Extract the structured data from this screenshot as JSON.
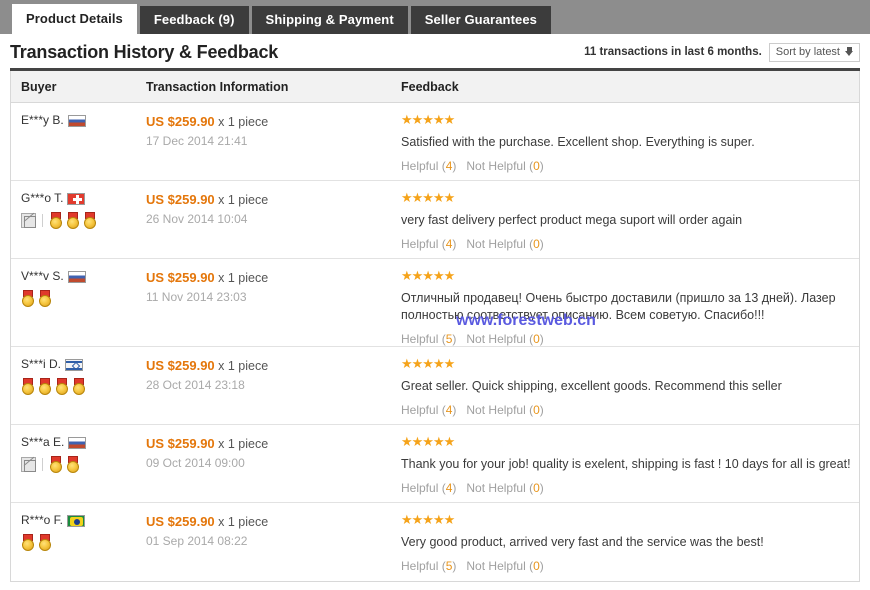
{
  "tabs": [
    {
      "label": "Product Details",
      "active": true
    },
    {
      "label": "Feedback (9)",
      "active": false
    },
    {
      "label": "Shipping & Payment",
      "active": false
    },
    {
      "label": "Seller Guarantees",
      "active": false
    }
  ],
  "section": {
    "title": "Transaction History & Feedback",
    "transaction_count_text": "11 transactions in last 6 months.",
    "sort_label": "Sort by latest"
  },
  "table": {
    "headers": {
      "buyer": "Buyer",
      "transaction": "Transaction Information",
      "feedback": "Feedback"
    },
    "rows": [
      {
        "buyer": "E***y B.",
        "flag": "flag-ru",
        "flag_name": "flag-russia",
        "badges": {
          "broken_icon": false,
          "medals": 0
        },
        "price_prefix": "US $259.90",
        "price_suffix": "x 1 piece",
        "date": "17 Dec 2014 21:41",
        "stars": 5,
        "feedback": "Satisfied with the purchase. Excellent shop. Everything is super.",
        "helpful_label": "Helpful",
        "helpful_count": "4",
        "not_helpful_label": "Not Helpful",
        "not_helpful_count": "0"
      },
      {
        "buyer": "G***o T.",
        "flag": "flag-ch",
        "flag_name": "flag-switzerland",
        "badges": {
          "broken_icon": true,
          "medals": 3
        },
        "price_prefix": "US $259.90",
        "price_suffix": "x 1 piece",
        "date": "26 Nov 2014 10:04",
        "stars": 5,
        "feedback": "very fast delivery perfect product mega suport will order again",
        "helpful_label": "Helpful",
        "helpful_count": "4",
        "not_helpful_label": "Not Helpful",
        "not_helpful_count": "0"
      },
      {
        "buyer": "V***v S.",
        "flag": "flag-ru",
        "flag_name": "flag-russia",
        "badges": {
          "broken_icon": false,
          "medals": 2
        },
        "price_prefix": "US $259.90",
        "price_suffix": "x 1 piece",
        "date": "11 Nov 2014 23:03",
        "stars": 5,
        "feedback": "Отличный продавец! Очень быстро доставили (пришло за 13 дней). Лазер полностью соответствует описанию. Всем советую. Спасибо!!!",
        "helpful_label": "Helpful",
        "helpful_count": "5",
        "not_helpful_label": "Not Helpful",
        "not_helpful_count": "0"
      },
      {
        "buyer": "S***i D.",
        "flag": "flag-il",
        "flag_name": "flag-israel",
        "badges": {
          "broken_icon": false,
          "medals": 4
        },
        "price_prefix": "US $259.90",
        "price_suffix": "x 1 piece",
        "date": "28 Oct 2014 23:18",
        "stars": 5,
        "feedback": "Great seller. Quick shipping, excellent goods. Recommend this seller",
        "helpful_label": "Helpful",
        "helpful_count": "4",
        "not_helpful_label": "Not Helpful",
        "not_helpful_count": "0"
      },
      {
        "buyer": "S***a E.",
        "flag": "flag-ru",
        "flag_name": "flag-russia",
        "badges": {
          "broken_icon": true,
          "medals": 2
        },
        "price_prefix": "US $259.90",
        "price_suffix": "x 1 piece",
        "date": "09 Oct 2014 09:00",
        "stars": 5,
        "feedback": "Thank you for your job! quality is exelent, shipping is fast ! 10 days for all is great!",
        "helpful_label": "Helpful",
        "helpful_count": "4",
        "not_helpful_label": "Not Helpful",
        "not_helpful_count": "0"
      },
      {
        "buyer": "R***o F.",
        "flag": "flag-br",
        "flag_name": "flag-brazil",
        "badges": {
          "broken_icon": false,
          "medals": 2
        },
        "price_prefix": "US $259.90",
        "price_suffix": "x 1 piece",
        "date": "01 Sep 2014 08:22",
        "stars": 5,
        "feedback": "Very good product, arrived very fast and the service was the best!",
        "helpful_label": "Helpful",
        "helpful_count": "5",
        "not_helpful_label": "Not Helpful",
        "not_helpful_count": "0"
      }
    ]
  },
  "watermark": {
    "text": "www.forestweb.cn",
    "color": "#5a5ae0"
  },
  "colors": {
    "price_orange": "#e4760a",
    "star_orange": "#f5a31a",
    "tab_active_bg": "#ffffff",
    "tab_bg": "#3c3c3c",
    "tabbar_bg": "#8d8d8d"
  }
}
